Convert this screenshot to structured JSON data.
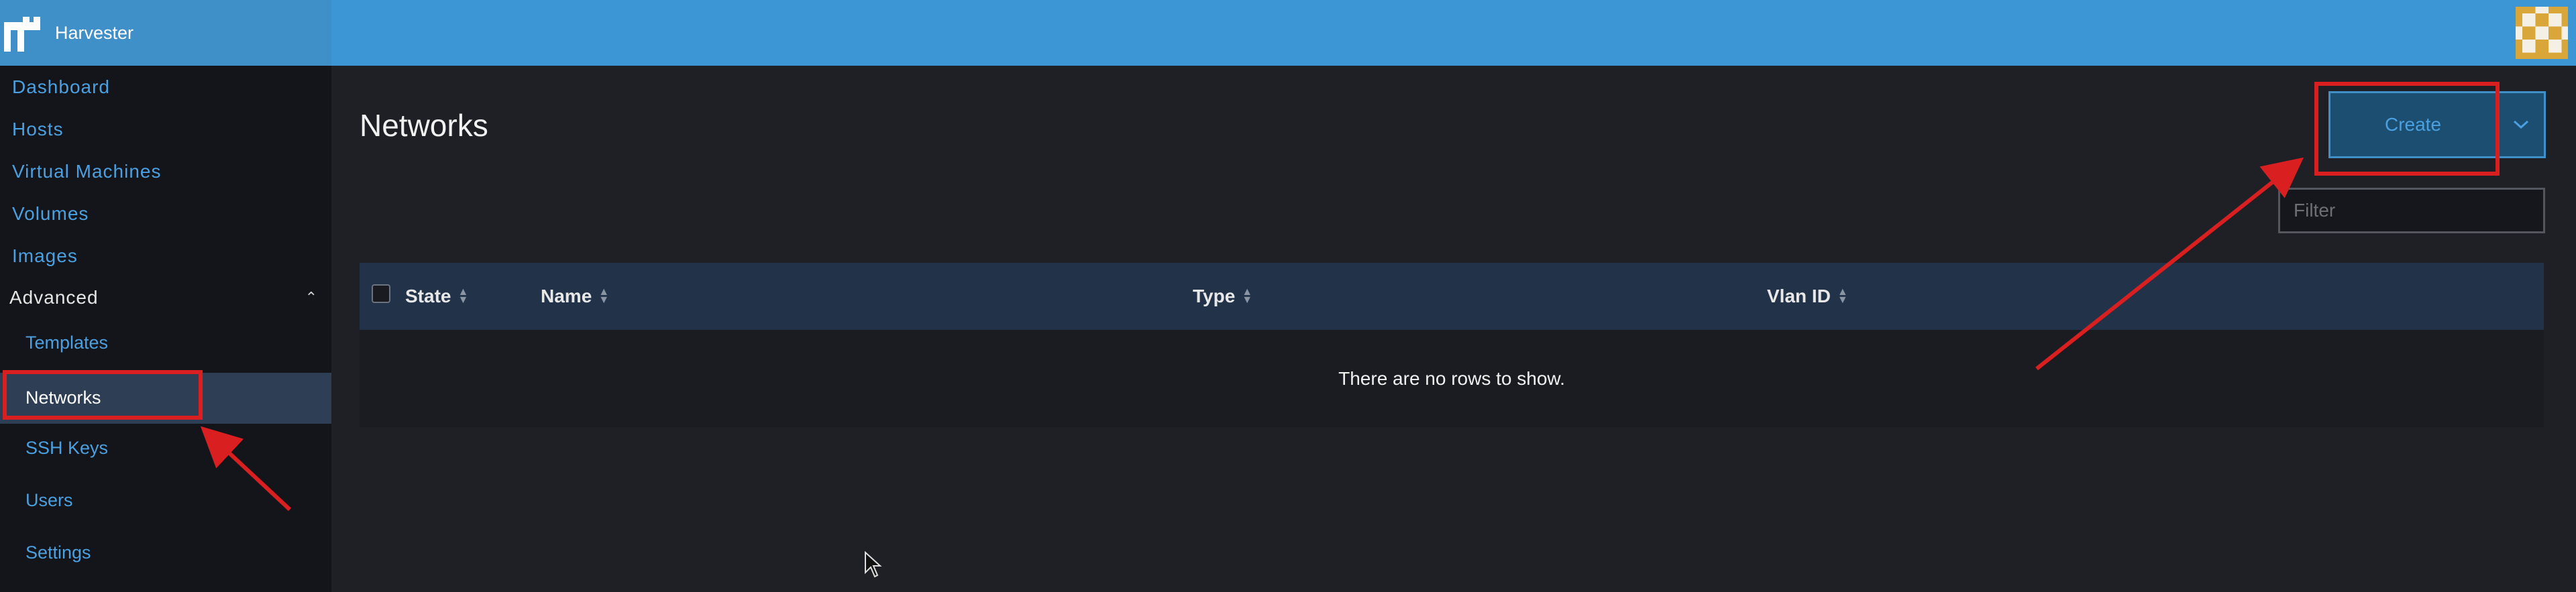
{
  "app": {
    "name": "Harvester"
  },
  "sidebar": {
    "items": [
      {
        "label": "Dashboard"
      },
      {
        "label": "Hosts"
      },
      {
        "label": "Virtual Machines"
      },
      {
        "label": "Volumes"
      },
      {
        "label": "Images"
      }
    ],
    "group": {
      "label": "Advanced",
      "items": [
        {
          "label": "Templates"
        },
        {
          "label": "Networks"
        },
        {
          "label": "SSH Keys"
        },
        {
          "label": "Users"
        },
        {
          "label": "Settings"
        }
      ]
    }
  },
  "main": {
    "title": "Networks",
    "create_label": "Create",
    "filter_placeholder": "Filter",
    "table": {
      "columns": [
        "State",
        "Name",
        "Type",
        "Vlan ID"
      ],
      "empty_message": "There are no rows to show."
    }
  },
  "colors": {
    "header": "#3c95d4",
    "sidebar": "#14151a",
    "accent": "#4aa0e0",
    "annotation": "#d91f1f"
  }
}
